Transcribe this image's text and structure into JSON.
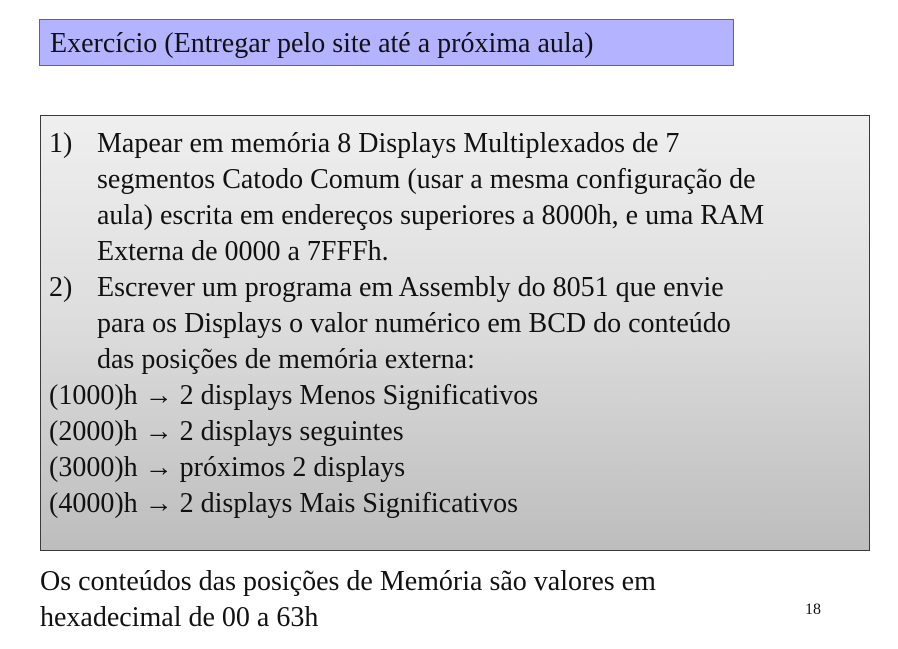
{
  "slide": {
    "title": "Exercício (Entregar pelo site até a próxima aula)",
    "items": [
      {
        "number": "1)",
        "text": "Mapear em memória 8 Displays Multiplexados de 7\nsegmentos Catodo Comum (usar a mesma configuração de\naula) escrita em endereços superiores a 8000h, e uma RAM\nExterna de 0000 a 7FFFh."
      },
      {
        "number": "2)",
        "text": " Escrever um programa em Assembly do 8051 que envie\npara os Displays o valor numérico em  BCD do conteúdo\ndas posições de memória externa:"
      }
    ],
    "mappings": [
      "(1000)h → 2 displays Menos Significativos",
      "(2000)h → 2 displays seguintes",
      "(3000)h → próximos 2 displays",
      "(4000)h → 2 displays Mais Significativos"
    ],
    "footer": "Os conteúdos das posições de Memória são valores em\nhexadecimal de 00 a 63h",
    "page_number": "18"
  }
}
